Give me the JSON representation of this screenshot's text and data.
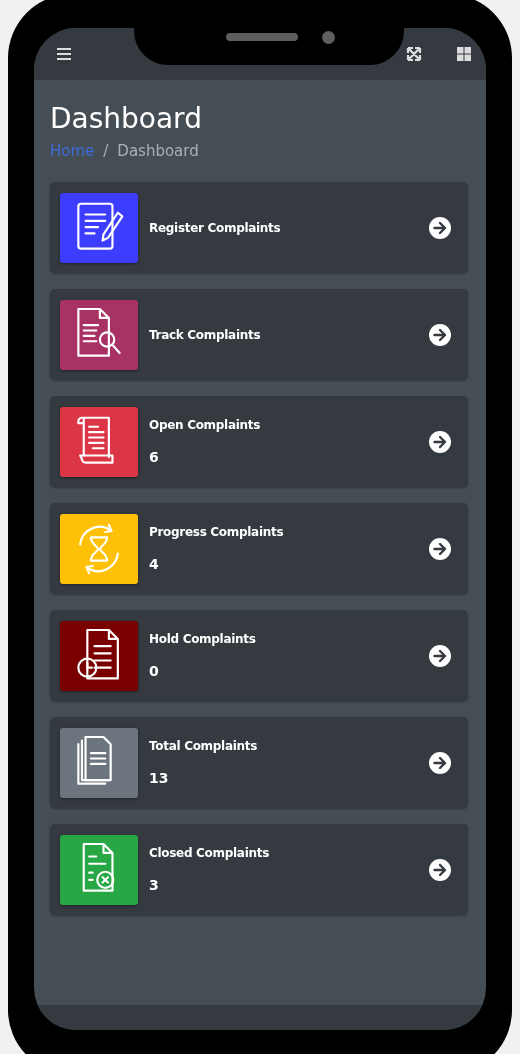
{
  "page": {
    "title": "Dashboard",
    "breadcrumb": [
      {
        "label": "Home",
        "kind": "link"
      },
      {
        "label": "/",
        "kind": "separator"
      },
      {
        "label": "Dashboard",
        "kind": "current"
      }
    ]
  },
  "cards": [
    {
      "kind": "register",
      "label": "Register Complaints",
      "color": "#3d3dff"
    },
    {
      "kind": "track",
      "label": "Track Complaints",
      "color": "#a83264"
    },
    {
      "kind": "open",
      "label": "Open Complaints",
      "count": "6",
      "color": "#dc3545"
    },
    {
      "kind": "progress",
      "label": "Progress Complaints",
      "count": "4",
      "color": "#ffc107"
    },
    {
      "kind": "hold",
      "label": "Hold Complaints",
      "count": "0",
      "color": "#7a0000"
    },
    {
      "kind": "total",
      "label": "Total Complaints",
      "count": "13",
      "color": "#6c757d"
    },
    {
      "kind": "closed",
      "label": "Closed Complaints",
      "count": "3",
      "color": "#28a745"
    }
  ]
}
